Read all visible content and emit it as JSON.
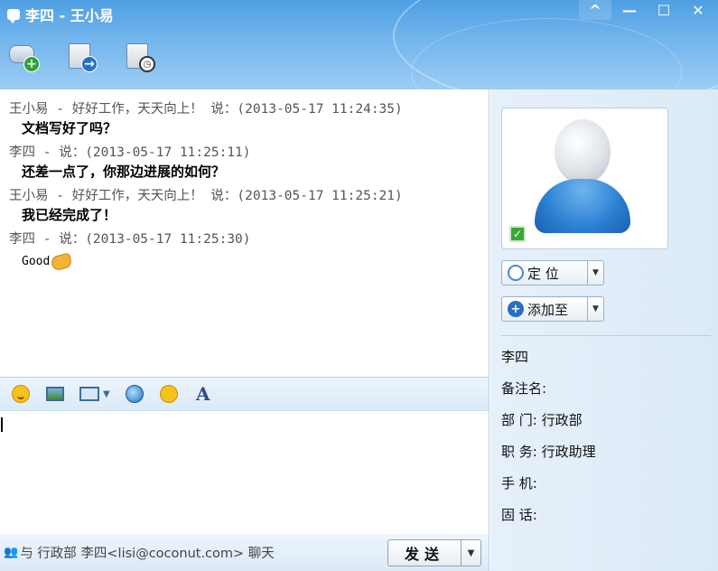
{
  "window": {
    "title": "李四 - 王小易",
    "controls": {
      "up": "^",
      "minimize": "—",
      "maximize": "☐",
      "close": "✕"
    }
  },
  "toolbar": {
    "icons": [
      "new-chat-icon",
      "send-file-icon",
      "history-icon"
    ]
  },
  "messages": [
    {
      "head": "王小易 - 好好工作，天天向上！ 说：(2013-05-17 11:24:35)",
      "body": "文档写好了吗？"
    },
    {
      "head": "李四 -  说：(2013-05-17 11:25:11)",
      "body": "还差一点了，你那边进展的如何？"
    },
    {
      "head": "王小易 - 好好工作，天天向上！ 说：(2013-05-17 11:25:21)",
      "body": "我已经完成了！"
    },
    {
      "head": "李四 -  说：(2013-05-17 11:25:30)",
      "body": "Good"
    }
  ],
  "edit_tools": [
    "smiley-icon",
    "image-icon",
    "screenshot-icon",
    "globe-icon",
    "wink-icon",
    "font-icon"
  ],
  "edit_font_label": "A",
  "status": {
    "text": "与 行政部 李四<lisi@coconut.com> 聊天"
  },
  "send": {
    "label": "发送",
    "dropdown": "▼"
  },
  "contact": {
    "locate_label": "定 位",
    "add_label": "添加至",
    "name": "李四",
    "remark_label": "备注名:",
    "remark_value": "",
    "dept_label": "部 门:",
    "dept_value": "行政部",
    "title_label": "职 务:",
    "title_value": "行政助理",
    "mobile_label": "手 机:",
    "mobile_value": "",
    "phone_label": "固 话:",
    "phone_value": ""
  },
  "colors": {
    "header_blue": "#5aa6e6",
    "panel_bg": "#e2edf8",
    "online_green": "#39a838"
  }
}
